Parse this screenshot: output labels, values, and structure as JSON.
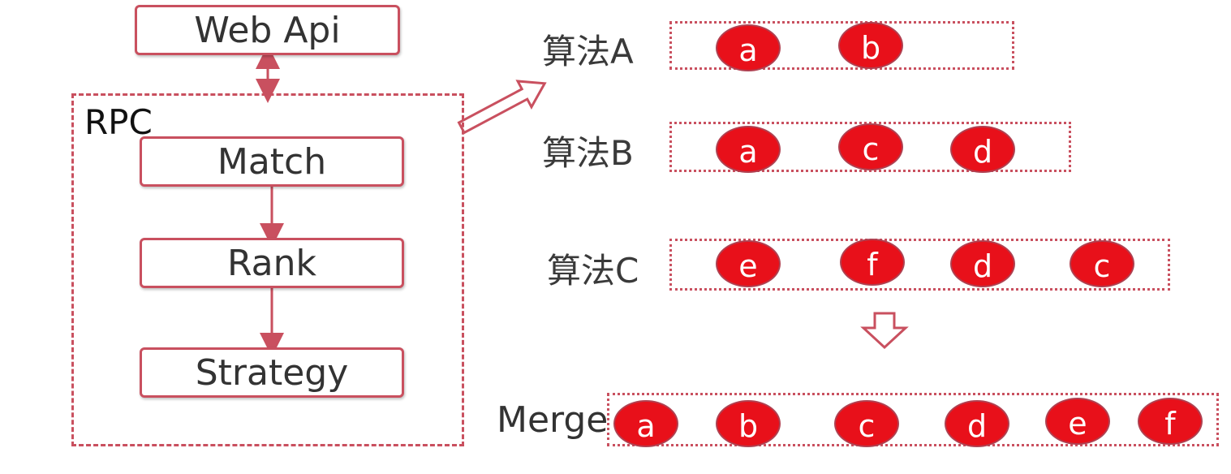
{
  "pipeline": {
    "web_api": "Web Api",
    "rpc": "RPC",
    "match": "Match",
    "rank": "Rank",
    "strategy": "Strategy"
  },
  "algorithms": [
    {
      "label": "算法A",
      "items": [
        "a",
        "b"
      ]
    },
    {
      "label": "算法B",
      "items": [
        "a",
        "c",
        "d"
      ]
    },
    {
      "label": "算法C",
      "items": [
        "e",
        "f",
        "d",
        "c"
      ]
    }
  ],
  "merge": {
    "label": "Merge",
    "items": [
      "a",
      "b",
      "c",
      "d",
      "e",
      "f"
    ]
  }
}
